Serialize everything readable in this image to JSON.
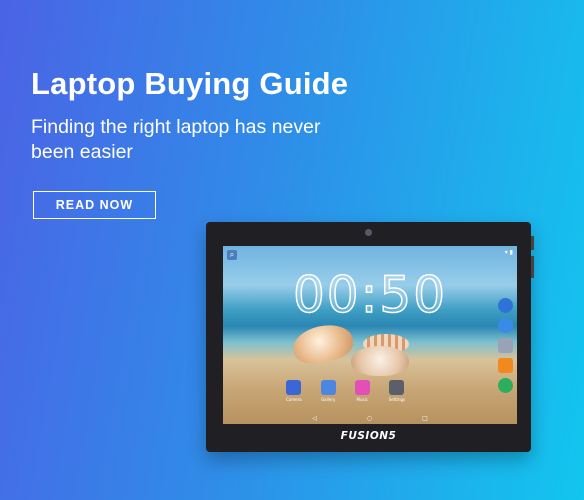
{
  "hero": {
    "title": "Laptop Buying Guide",
    "subtitle": "Finding the right laptop has never been easier",
    "cta_label": "READ NOW"
  },
  "tablet": {
    "clock": "00:50",
    "brand": "FUSION5",
    "dock_apps": [
      {
        "label": "Camera",
        "color": "#3b67d6"
      },
      {
        "label": "Gallery",
        "color": "#4b86e0"
      },
      {
        "label": "Music",
        "color": "#e24fb6"
      },
      {
        "label": "Settings",
        "color": "#5a5f6a"
      }
    ],
    "rail_apps": [
      {
        "icon": "browser-icon",
        "color": "#2f73d8"
      },
      {
        "icon": "messages-icon",
        "color": "#3a8be8"
      },
      {
        "icon": "apps-grid-icon",
        "color": "#9aa3b5"
      },
      {
        "icon": "contacts-icon",
        "color": "#f08a1e"
      },
      {
        "icon": "phone-icon",
        "color": "#2cae5d"
      }
    ]
  },
  "colors": {
    "gradient_start": "#4b63e6",
    "gradient_end": "#12c6ef",
    "text": "#ffffff"
  }
}
